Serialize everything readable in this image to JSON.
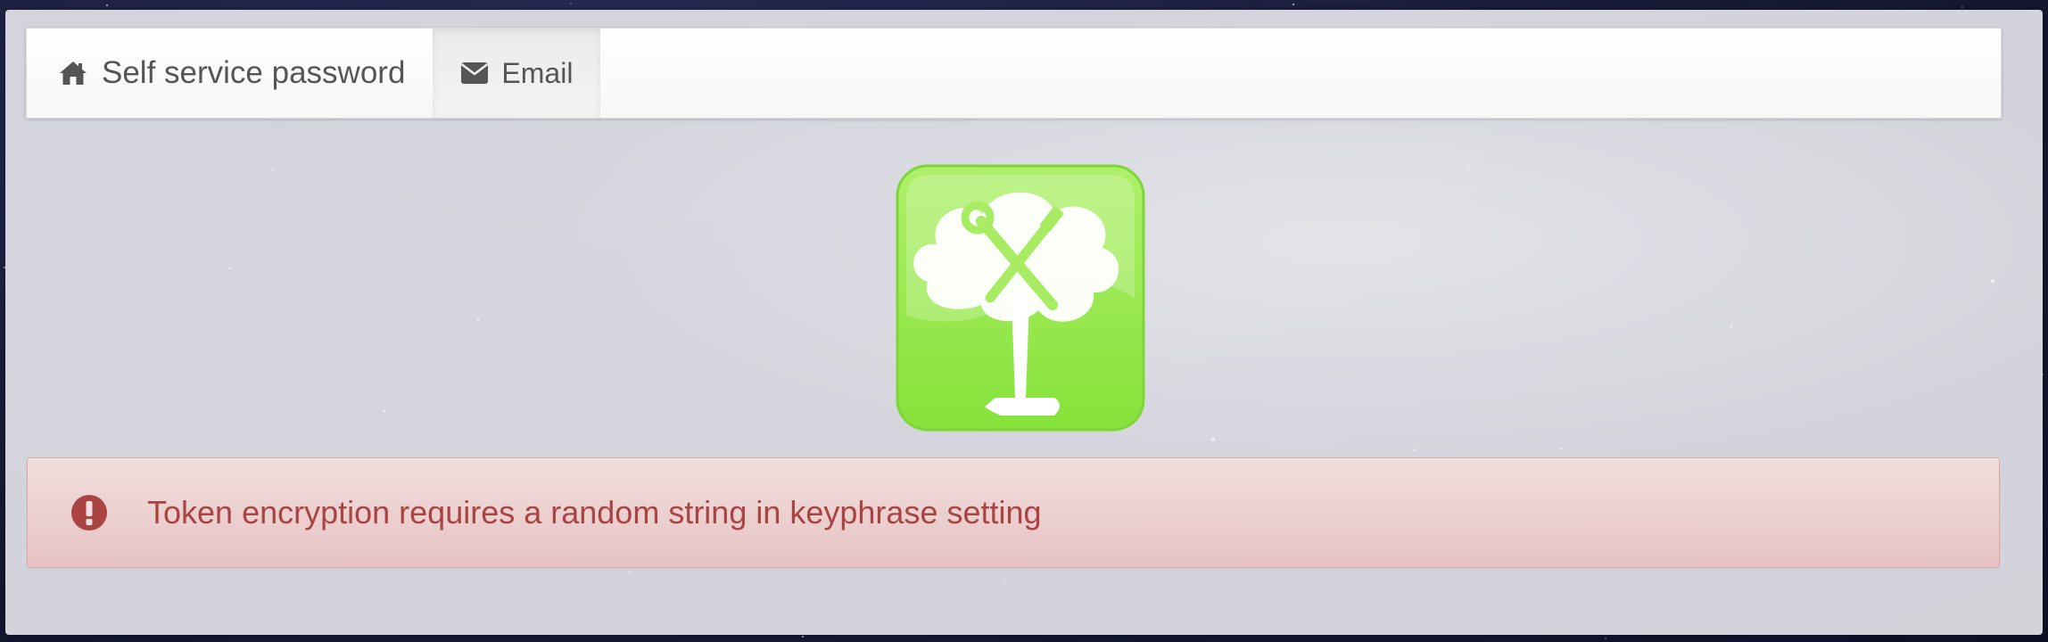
{
  "navbar": {
    "brand": {
      "label": "Self service password",
      "icon": "home-icon"
    },
    "items": [
      {
        "label": "Email",
        "icon": "envelope-icon"
      }
    ]
  },
  "logo": {
    "icon": "tree-tools-logo"
  },
  "alert": {
    "type": "danger",
    "icon": "exclamation-circle-icon",
    "message": "Token encryption requires a random string in keyphrase setting"
  },
  "colors": {
    "alert_text": "#a94442",
    "alert_bg": "#f2dede",
    "logo_green": "#8ee63e",
    "nav_text": "#555555"
  }
}
